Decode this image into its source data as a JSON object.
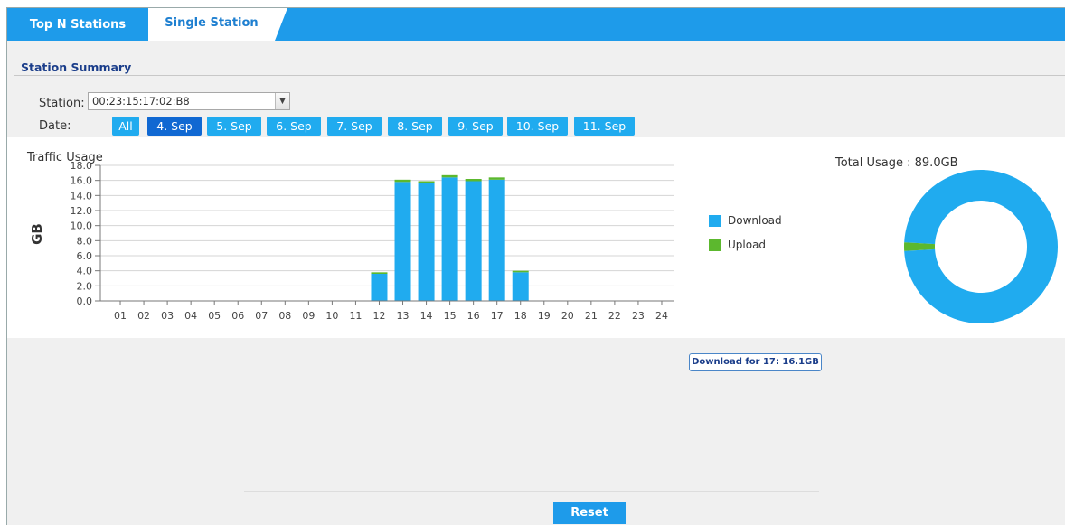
{
  "tabs": [
    {
      "label": "Top N Stations"
    },
    {
      "label": "Single Station"
    }
  ],
  "section_title": "Station Summary",
  "station": {
    "label": "Station:",
    "value": "00:23:15:17:02:B8"
  },
  "date": {
    "label": "Date:",
    "options": [
      "All",
      "4. Sep",
      "5. Sep",
      "6. Sep",
      "7. Sep",
      "8. Sep",
      "9. Sep",
      "10. Sep",
      "11. Sep"
    ],
    "selected": "4. Sep"
  },
  "total_usage": "Total Usage : 89.0GB",
  "tooltip": "Download for 17: 16.1GB",
  "reset_label": "Reset",
  "colors": {
    "accent": "#1e9bea",
    "download": "#20abef",
    "upload": "#5cb82e",
    "active_date": "#1068d2"
  },
  "chart_data": [
    {
      "type": "bar",
      "title": "Traffic Usage",
      "xlabel": "",
      "ylabel": "GB",
      "ylim": [
        0,
        18
      ],
      "yticks": [
        "0.0",
        "2.0",
        "4.0",
        "6.0",
        "8.0",
        "10.0",
        "12.0",
        "14.0",
        "16.0",
        "18.0"
      ],
      "categories": [
        "01",
        "02",
        "03",
        "04",
        "05",
        "06",
        "07",
        "08",
        "09",
        "10",
        "11",
        "12",
        "13",
        "14",
        "15",
        "16",
        "17",
        "18",
        "19",
        "20",
        "21",
        "22",
        "23",
        "24"
      ],
      "stacked": true,
      "grid": true,
      "legend": "right",
      "series": [
        {
          "name": "Download",
          "values": [
            0,
            0,
            0,
            0,
            0,
            0,
            0,
            0,
            0,
            0,
            0,
            3.6,
            15.8,
            15.6,
            16.4,
            15.9,
            16.1,
            3.8,
            0,
            0,
            0,
            0,
            0,
            0
          ]
        },
        {
          "name": "Upload",
          "values": [
            0,
            0,
            0,
            0,
            0,
            0,
            0,
            0,
            0,
            0,
            0,
            0.2,
            0.3,
            0.3,
            0.3,
            0.3,
            0.3,
            0.2,
            0,
            0,
            0,
            0,
            0,
            0
          ]
        }
      ]
    },
    {
      "type": "pie",
      "title": "Total Usage : 89.0GB",
      "donut": true,
      "categories": [
        "Download",
        "Upload"
      ],
      "values": [
        87.4,
        1.6
      ]
    }
  ]
}
